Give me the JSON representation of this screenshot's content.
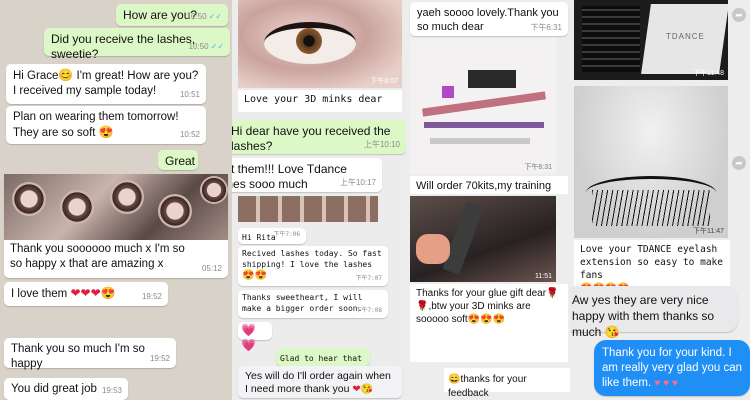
{
  "p1": {
    "msg1": {
      "text": "How are you?",
      "time": "10:50"
    },
    "msg2": {
      "text": "Did you receive the lashes, sweetie?",
      "time": "10:50"
    },
    "msg3": {
      "text_a": "Hi Grace",
      "text_b": " I'm great! How are you? I received my sample today!",
      "time": "10:51"
    },
    "msg4": {
      "text": "Plan on wearing them tomorrow! They are so soft",
      "time": "10:52"
    },
    "msg5": {
      "text": "Great"
    },
    "msg6": {
      "text": "Thank you soooooo much x I'm so so happy x that are amazing x",
      "time": "05:12"
    },
    "msg7": {
      "text": "I love them",
      "time": "19:52"
    },
    "msg8": {
      "text": "Thank you so much I'm so happy",
      "time": "19:52"
    },
    "msg9": {
      "text": "You did great job",
      "time": "19:53"
    }
  },
  "p2": {
    "photo_time": "下午8:07",
    "caption": "Love your 3D minks dear",
    "msg1": {
      "text": "Hi dear have you received the lashes?",
      "time": "上午10:10"
    },
    "msg2": {
      "text": "I got them!!!  Love Tdance lashes sooo much",
      "time": "上午10:17"
    },
    "rita": {
      "text": "Hi Rita",
      "time": "下午7:06"
    },
    "received": {
      "text": "Recived lashes today. So fast shipping! I love the lashes",
      "time": "下午7:07"
    },
    "thanks": {
      "text": "Thanks sweetheart, I will make a bigger order soon.",
      "time": "下午7:08"
    },
    "glad": {
      "text": "Glad to hear that"
    },
    "again": {
      "text": "Yes will do I'll order again when I need more thank you"
    }
  },
  "p3": {
    "top": {
      "text": "yaeh  soooo lovely.Thank you so much dear",
      "time": "下午6:31"
    },
    "kit_time": "下午6:31",
    "kit_caption": "Will order 70kits,my training",
    "glue_time": "11:51",
    "glue": {
      "text_a": "Thanks for your glue gift dear",
      "text_b": ",btw your 3D minks are sooooo soft"
    },
    "feedback": {
      "text": "thanks for your feedback"
    }
  },
  "p4": {
    "time1": "下午11:48",
    "time2": "下午11:47",
    "caption": "Love your TDANCE eyelash extension so easy to make fans",
    "brand": "TDANCE",
    "msg1": {
      "text": "Aw yes they are very nice happy with them thanks so much"
    },
    "msg2": {
      "text": "Thank you for your kind. I am really very glad you can like them."
    }
  }
}
